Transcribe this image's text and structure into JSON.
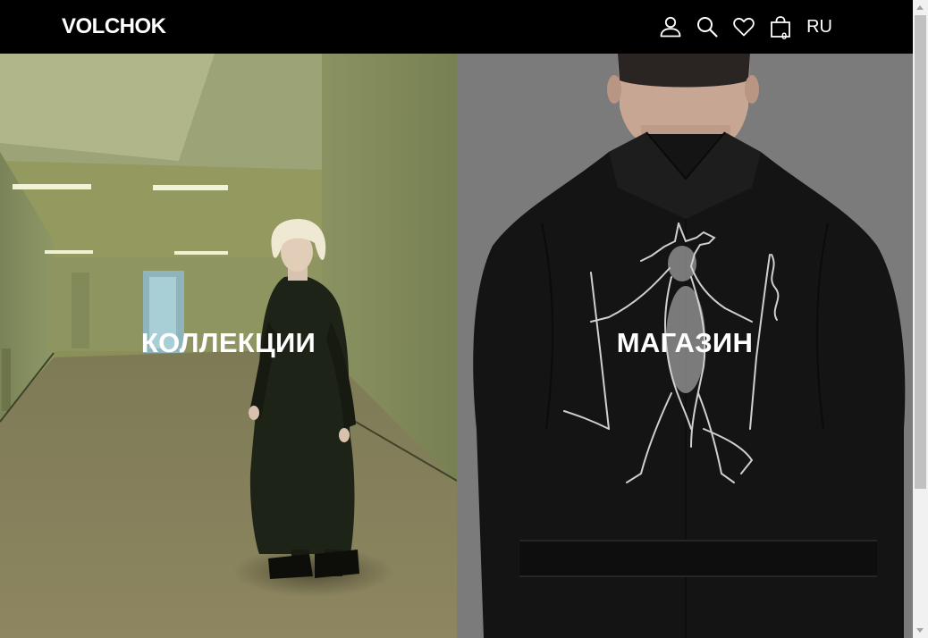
{
  "header": {
    "logo": "VOLCHOK",
    "icons": [
      "user-icon",
      "search-icon",
      "heart-icon",
      "cart-icon"
    ],
    "cart_count": "0",
    "language": "RU"
  },
  "panels": {
    "left": {
      "label": "КОЛЛЕКЦИИ"
    },
    "right": {
      "label": "МАГАЗИН"
    }
  },
  "colors": {
    "header_bg": "#000000",
    "text": "#ffffff",
    "left_panel_tone": "#8b8f58",
    "right_panel_tone": "#7b7b7b"
  }
}
